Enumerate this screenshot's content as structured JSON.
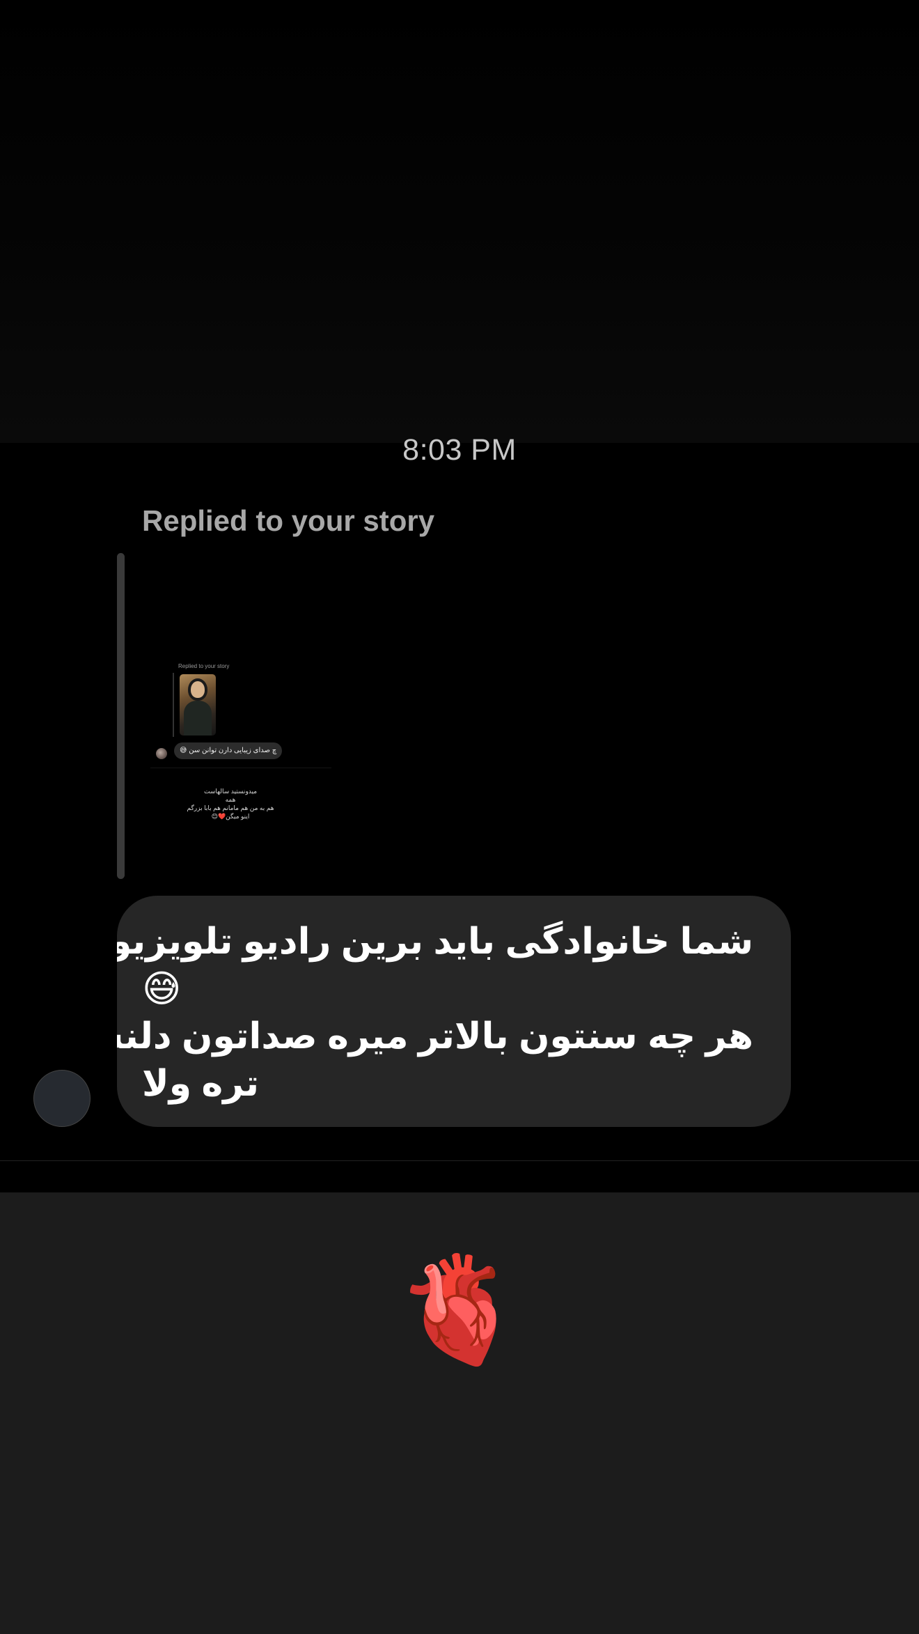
{
  "thread": {
    "timestamp": "8:03 PM",
    "reply_label": "Replied to your story"
  },
  "story_preview": {
    "label": "Replied to your story",
    "bubble_text": "چ صدای زیبایی دارن توانن سن 😅",
    "caption_lines": [
      "میدونستید سالهاست",
      "همه",
      "هم به من هم مامانم هم بابا بزرگم",
      "اینو میگن❤️😊"
    ]
  },
  "message": {
    "line1": "شما خانوادگی باید برین رادیو تلویزیون",
    "emoji": "😅",
    "line2": "هر چه سنتون بالاتر میره صداتون دلنشین",
    "line3": "تره ولا"
  },
  "reaction": {
    "emoji": "🫀"
  }
}
